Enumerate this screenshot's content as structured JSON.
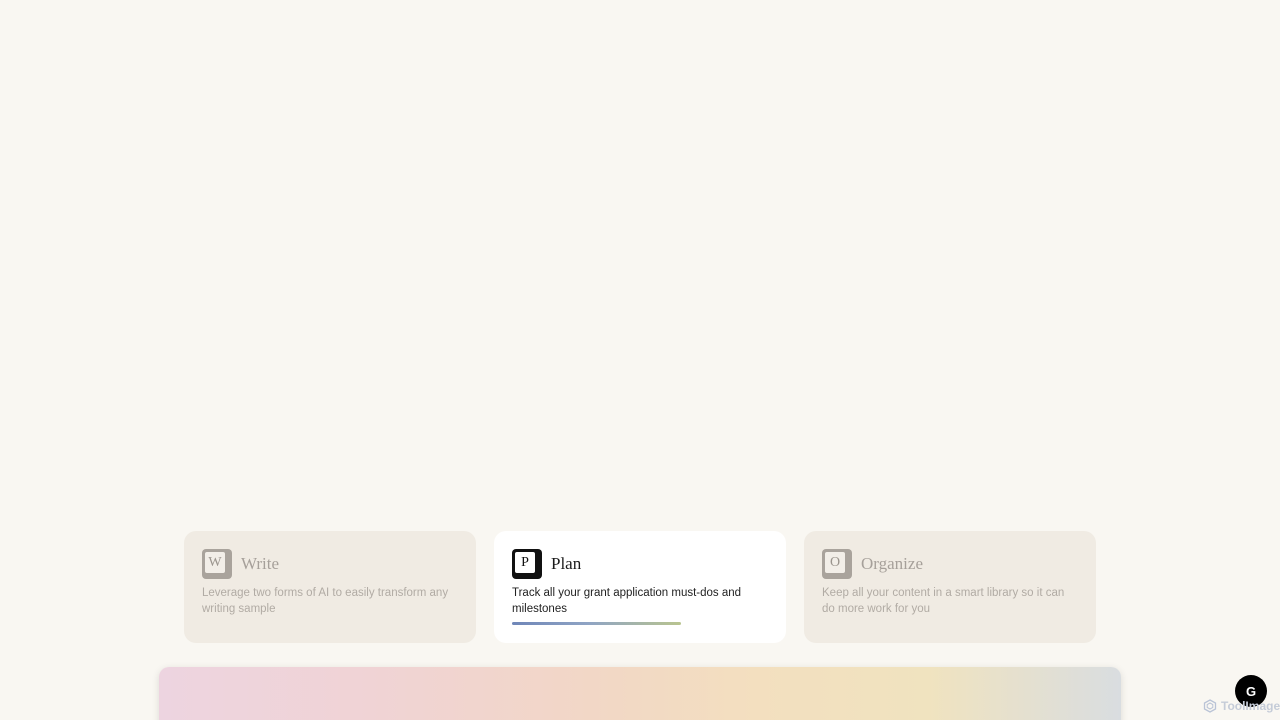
{
  "features": {
    "write": {
      "key_letter": "W",
      "title": "Write",
      "description": "Leverage two forms of AI to easily transform any writing sample"
    },
    "plan": {
      "key_letter": "P",
      "title": "Plan",
      "description": "Track all your grant application must-dos and milestones",
      "progress": 0.66
    },
    "organize": {
      "key_letter": "O",
      "title": "Organize",
      "description": "Keep all your content in a smart library so it can do more work for you"
    }
  },
  "fab": {
    "glyph": "G",
    "icon": "g-logo-icon"
  },
  "watermark": {
    "text": "ToolImage",
    "icon": "hexagon-logo-icon"
  },
  "colors": {
    "background": "#f9f7f2",
    "card_inactive": "#f0ebe3",
    "card_active": "#ffffff",
    "progress_start": "#6f86b8",
    "progress_end": "#b9c48f"
  }
}
